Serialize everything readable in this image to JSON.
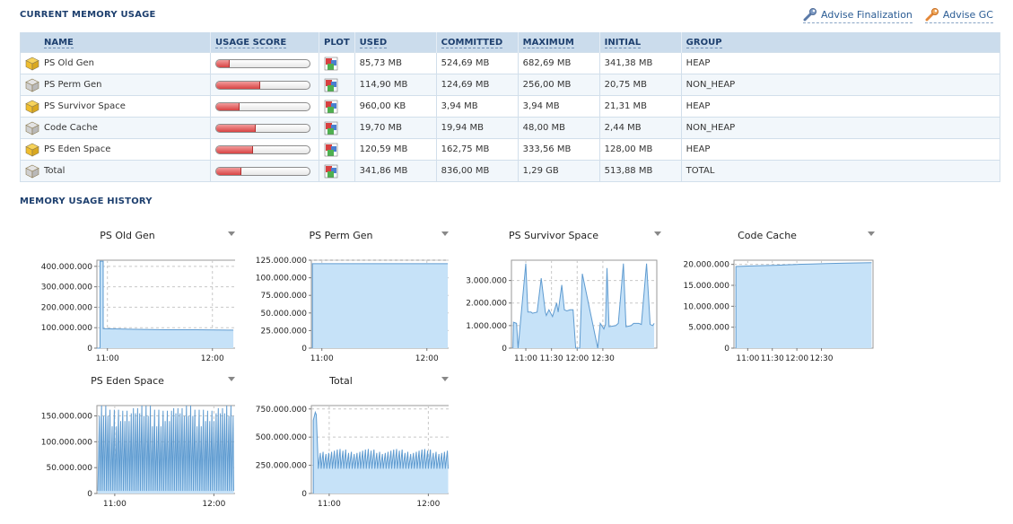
{
  "header": {
    "current_title": "CURRENT MEMORY USAGE",
    "history_title": "MEMORY USAGE HISTORY",
    "advise_finalization": "Advise Finalization",
    "advise_gc": "Advise GC"
  },
  "table": {
    "columns": [
      "NAME",
      "USAGE SCORE",
      "PLOT",
      "USED",
      "COMMITTED",
      "MAXIMUM",
      "INITIAL",
      "GROUP"
    ],
    "rows": [
      {
        "name": "PS Old Gen",
        "score": 0.13,
        "used": "85,73 MB",
        "committed": "524,69 MB",
        "maximum": "682,69 MB",
        "initial": "341,38 MB",
        "group": "HEAP",
        "icon": "heap-cube-icon"
      },
      {
        "name": "PS Perm Gen",
        "score": 0.46,
        "used": "114,90 MB",
        "committed": "124,69 MB",
        "maximum": "256,00 MB",
        "initial": "20,75 MB",
        "group": "NON_HEAP",
        "icon": "nonheap-cube-icon"
      },
      {
        "name": "PS Survivor Space",
        "score": 0.24,
        "used": "960,00 KB",
        "committed": "3,94 MB",
        "maximum": "3,94 MB",
        "initial": "21,31 MB",
        "group": "HEAP",
        "icon": "heap-cube-icon"
      },
      {
        "name": "Code Cache",
        "score": 0.41,
        "used": "19,70 MB",
        "committed": "19,94 MB",
        "maximum": "48,00 MB",
        "initial": "2,44 MB",
        "group": "NON_HEAP",
        "icon": "nonheap-cube-icon"
      },
      {
        "name": "PS Eden Space",
        "score": 0.38,
        "used": "120,59 MB",
        "committed": "162,75 MB",
        "maximum": "333,56 MB",
        "initial": "128,00 MB",
        "group": "HEAP",
        "icon": "heap-cube-icon"
      },
      {
        "name": "Total",
        "score": 0.26,
        "used": "341,86 MB",
        "committed": "836,00 MB",
        "maximum": "1,29 GB",
        "initial": "513,88 MB",
        "group": "TOTAL",
        "icon": "nonheap-cube-icon"
      }
    ]
  },
  "chart_data": [
    {
      "type": "area",
      "title": "PS Old Gen",
      "y_ticks": [
        "400.000.000",
        "300.000.000",
        "200.000.000",
        "100.000.000",
        "0"
      ],
      "ylim": [
        0,
        430000000
      ],
      "x_ticks": [
        "11:00",
        "12:00"
      ],
      "xlim": [
        0.9,
        2.25
      ],
      "x": [
        0.9,
        0.93,
        0.93,
        0.96,
        0.96,
        1.25,
        1.55,
        1.85,
        2.2
      ],
      "y": [
        0,
        0,
        425000000,
        425000000,
        95000000,
        92000000,
        90000000,
        90000000,
        88000000
      ]
    },
    {
      "type": "area",
      "title": "PS Perm Gen",
      "y_ticks": [
        "125.000.000",
        "100.000.000",
        "75.000.000",
        "50.000.000",
        "25.000.000",
        "0"
      ],
      "ylim": [
        0,
        125000000
      ],
      "x_ticks": [
        "11:00",
        "12:00"
      ],
      "xlim": [
        0.9,
        2.25
      ],
      "x": [
        0.91,
        0.91,
        2.2
      ],
      "y": [
        0,
        120000000,
        120000000
      ]
    },
    {
      "type": "area",
      "title": "PS Survivor Space",
      "y_ticks": [
        "3.000.000",
        "2.000.000",
        "1.000.000",
        "0"
      ],
      "ylim": [
        0,
        3900000
      ],
      "x_ticks": [
        "11:00",
        "11:30",
        "12:00",
        "12:30"
      ],
      "xlim": [
        0.72,
        3.55
      ],
      "x": [
        0.75,
        0.76,
        0.82,
        0.85,
        1.0,
        1.04,
        1.1,
        1.13,
        1.22,
        1.3,
        1.38,
        1.4,
        1.45,
        1.52,
        1.6,
        1.63,
        1.7,
        1.75,
        1.8,
        1.86,
        1.92,
        1.97,
        2.05,
        2.1,
        2.4,
        2.45,
        2.52,
        2.55,
        2.58,
        2.62,
        2.75,
        2.8,
        2.9,
        2.95,
        3.05,
        3.1,
        3.2,
        3.25,
        3.35,
        3.42,
        3.47,
        3.5
      ],
      "y": [
        0,
        1150000,
        1100000,
        0,
        3750000,
        1600000,
        1600000,
        1550000,
        1600000,
        3100000,
        1600000,
        1450000,
        1700000,
        1400000,
        2000000,
        1600000,
        2800000,
        1700000,
        1650000,
        1700000,
        1700000,
        0,
        0,
        3300000,
        0,
        1100000,
        850000,
        1050000,
        3550000,
        950000,
        1000000,
        1100000,
        3750000,
        950000,
        1000000,
        1100000,
        1100000,
        1050000,
        3750000,
        1050000,
        1000000,
        1100000
      ]
    },
    {
      "type": "area",
      "title": "Code Cache",
      "y_ticks": [
        "20.000.000",
        "15.000.000",
        "10.000.000",
        "5.000.000",
        "0"
      ],
      "ylim": [
        0,
        21000000
      ],
      "x_ticks": [
        "11:00",
        "11:30",
        "12:00",
        "12:30"
      ],
      "xlim": [
        0.72,
        3.55
      ],
      "x": [
        0.76,
        0.76,
        1.0,
        1.6,
        1.8,
        2.0,
        2.3,
        2.6,
        3.0,
        3.52
      ],
      "y": [
        0,
        19500000,
        19600000,
        19800000,
        19900000,
        20000000,
        20100000,
        20200000,
        20300000,
        20400000
      ]
    },
    {
      "type": "area",
      "title": "PS Eden Space",
      "y_ticks": [
        "150.000.000",
        "100.000.000",
        "50.000.000",
        "0"
      ],
      "ylim": [
        0,
        170000000
      ],
      "x_ticks": [
        "11:00",
        "12:00"
      ],
      "xlim": [
        0.82,
        2.25
      ],
      "saw": {
        "x_start": 0.83,
        "x_end": 2.2,
        "cycles": 64,
        "low": 5000000,
        "high_values": [
          150000000,
          165000000,
          160000000,
          130000000,
          170000000,
          155000000,
          140000000,
          162000000
        ]
      }
    },
    {
      "type": "area",
      "title": "Total",
      "y_ticks": [
        "750.000.000",
        "500.000.000",
        "250.000.000",
        "0"
      ],
      "ylim": [
        0,
        780000000
      ],
      "x_ticks": [
        "11:00",
        "12:00"
      ],
      "xlim": [
        0.82,
        2.25
      ],
      "head": {
        "x": [
          0.84,
          0.84,
          0.86,
          0.87,
          0.89
        ],
        "y": [
          0,
          650000000,
          720000000,
          700000000,
          250000000
        ]
      },
      "saw": {
        "x_start": 0.89,
        "x_end": 2.2,
        "cycles": 46,
        "low": 220000000,
        "high_values": [
          360000000,
          390000000,
          350000000,
          380000000,
          370000000,
          395000000
        ]
      }
    }
  ],
  "icons": {
    "wrench": "wrench-icon",
    "plot": "plot-icon",
    "menu": "chevron-down-icon"
  }
}
